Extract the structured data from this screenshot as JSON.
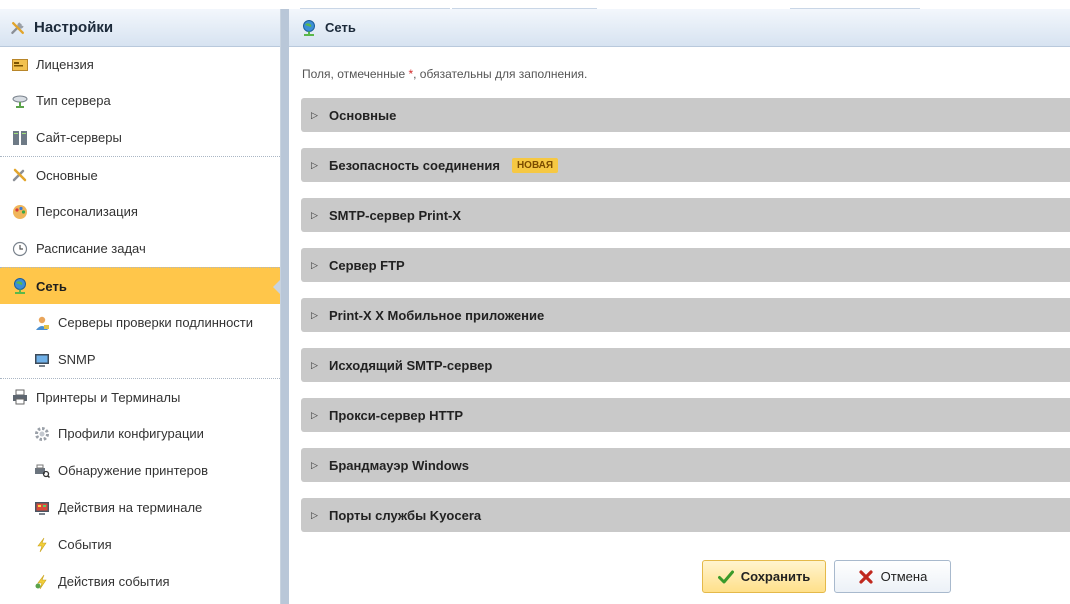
{
  "sidebar": {
    "title": "Настройки",
    "items": [
      {
        "label": "Лицензия",
        "icon": "license-icon"
      },
      {
        "label": "Тип сервера",
        "icon": "server-type-icon"
      },
      {
        "label": "Сайт-серверы",
        "icon": "site-servers-icon"
      },
      {
        "label": "Основные",
        "icon": "tools-icon"
      },
      {
        "label": "Персонализация",
        "icon": "palette-icon"
      },
      {
        "label": "Расписание задач",
        "icon": "clock-icon"
      },
      {
        "label": "Сеть",
        "icon": "network-icon",
        "active": true
      },
      {
        "label": "Серверы проверки подлинности",
        "icon": "auth-user-icon"
      },
      {
        "label": "SNMP",
        "icon": "snmp-monitor-icon"
      },
      {
        "label": "Принтеры и Терминалы",
        "icon": "printer-icon"
      },
      {
        "label": "Профили конфигурации",
        "icon": "gear-icon"
      },
      {
        "label": "Обнаружение принтеров",
        "icon": "printer-search-icon"
      },
      {
        "label": "Действия на терминале",
        "icon": "terminal-icon"
      },
      {
        "label": "События",
        "icon": "lightning-icon"
      },
      {
        "label": "Действия события",
        "icon": "event-action-icon"
      }
    ]
  },
  "main": {
    "title": "Сеть",
    "hint_prefix": "Поля, отмеченные ",
    "hint_star": "*",
    "hint_suffix": ", обязательны для заполнения.",
    "sections": [
      {
        "label": "Основные"
      },
      {
        "label": "Безопасность соединения",
        "badge": "НОВАЯ"
      },
      {
        "label": "SMTP-сервер Print-X"
      },
      {
        "label": "Сервер FTP"
      },
      {
        "label": "Print-X X Мобильное приложение"
      },
      {
        "label": "Исходящий SMTP-сервер"
      },
      {
        "label": "Прокси-сервер HTTP"
      },
      {
        "label": "Брандмауэр Windows"
      },
      {
        "label": "Порты службы Kyocera"
      }
    ],
    "save_label": "Сохранить",
    "cancel_label": "Отмена"
  },
  "colors": {
    "active": "#ffc64a",
    "header": "#d7e3f1",
    "section": "#c9c9c9",
    "badge": "#f6c843",
    "required": "#d12a2a"
  }
}
